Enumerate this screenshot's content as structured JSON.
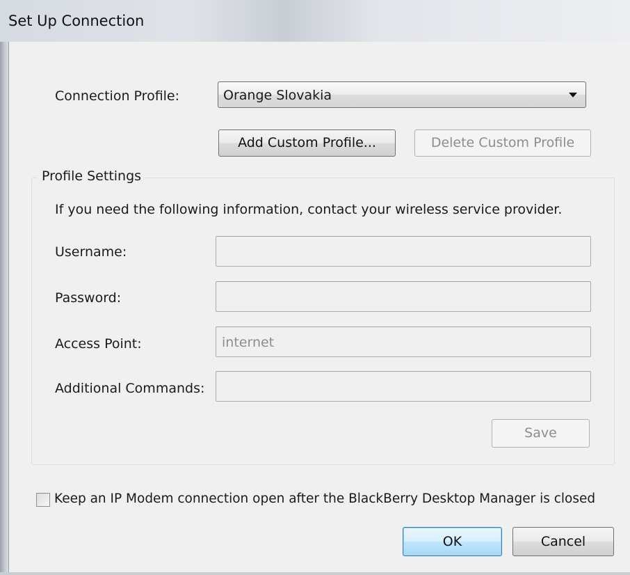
{
  "window": {
    "title": "Set Up Connection"
  },
  "connection_profile": {
    "label": "Connection Profile:",
    "selected": "Orange Slovakia"
  },
  "buttons": {
    "add_custom_profile": "Add Custom Profile...",
    "delete_custom_profile": "Delete Custom Profile",
    "save": "Save",
    "ok": "OK",
    "cancel": "Cancel"
  },
  "profile_settings": {
    "legend": "Profile Settings",
    "info": "If you need the following information, contact your wireless service provider.",
    "username_label": "Username:",
    "username_value": "",
    "password_label": "Password:",
    "password_value": "",
    "access_point_label": "Access Point:",
    "access_point_value": "internet",
    "additional_commands_label": "Additional Commands:",
    "additional_commands_value": ""
  },
  "keep_open": {
    "label": "Keep an IP Modem connection open after the BlackBerry Desktop Manager is closed",
    "checked": false
  }
}
